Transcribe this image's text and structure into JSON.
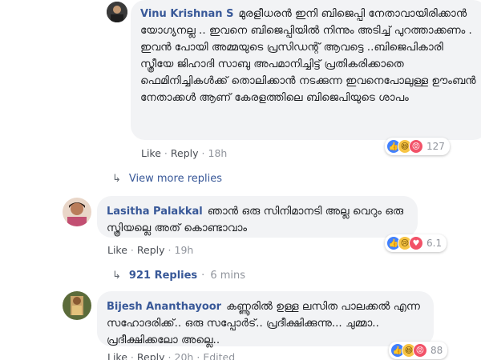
{
  "comments": [
    {
      "author": "Vinu Krishnan S",
      "text": "മുരളീധരൻ ഇനി ബിജെപ്പി നേതാവായിരിക്കാൻ യോഗ്യനല്ല .. ഇവനെ ബിജെപ്പിയിൽ നിന്നും അടിച്ച് പുറത്താക്കണം . ഇവൻ പോയി അമ്മയുടെ പ്രസിഡന്റ് ആവട്ടെ ..ബിജെപികാരി സ്ത്രീയേ ജിഹാദി സാബു അപമാനിച്ചിട്ട് പ്രതികരിക്കാതെ ഫെമിനിച്ചികൾക്ക് തൊലിക്കാൻ നടക്കുന്ന ഇവനെപോലുള്ള ഊംബൻ നേതാക്കൾ ആണ് കേരളത്തിലെ ബിജെപിയുടെ ശാപം",
      "like": "Like",
      "reply": "Reply",
      "time": "18h",
      "reaction_count": "127",
      "reactions": [
        "like-icon",
        "haha-icon",
        "angry-icon"
      ]
    },
    {
      "author": "Lasitha Palakkal",
      "text": "ഞാൻ ഒരു സിനിമാനടി അല്ല വെറും ഒരു സ്ത്രിയല്ലെ അത് കൊണ്ടാവാം",
      "like": "Like",
      "reply": "Reply",
      "time": "19h",
      "reaction_count": "6.1",
      "reactions": [
        "like-icon",
        "sad-icon",
        "love-icon"
      ]
    },
    {
      "author": "Bijesh Ananthayoor",
      "text": "കണ്ണൂരിൽ ഉള്ള ലസിത പാലക്കൽ എന്ന സഹോദരിക്ക്.. ഒരു സപ്പോർട്.. പ്രദീക്ഷിക്കുന്നു... ചുമ്മാ.. പ്രദീക്ഷിക്കലോ അല്ലെ..",
      "like": "Like",
      "reply": "Reply",
      "time": "20h",
      "edited": "Edited",
      "reaction_count": "88",
      "reactions": [
        "like-icon",
        "haha-icon",
        "angry-icon"
      ]
    }
  ],
  "view_more": "View more replies",
  "replies_link": {
    "label": "921 Replies",
    "time": "6 mins"
  },
  "colors": {
    "name": "#385898",
    "bubble": "#f2f3f5",
    "meta": "#90949c"
  }
}
